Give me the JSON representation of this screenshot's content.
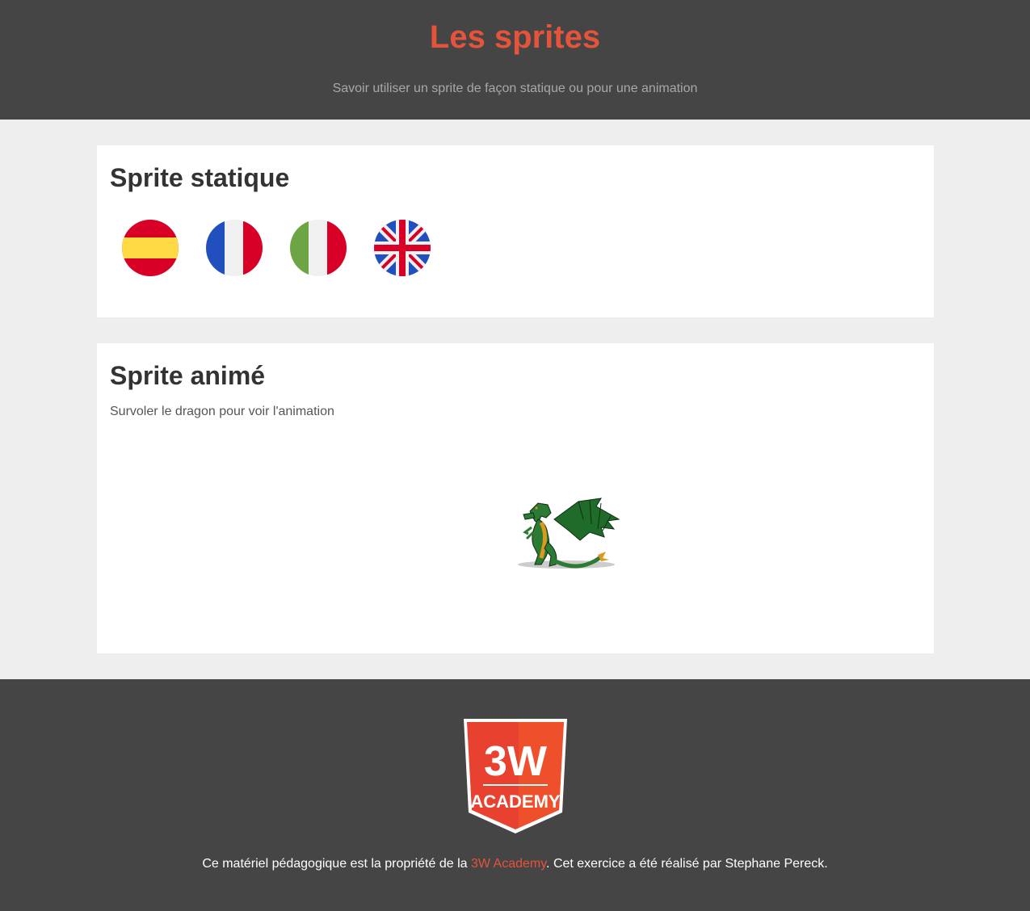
{
  "header": {
    "title": "Les sprites",
    "subtitle": "Savoir utiliser un sprite de façon statique ou pour une animation"
  },
  "static_section": {
    "title": "Sprite statique",
    "flags": [
      "spain-flag-icon",
      "france-flag-icon",
      "italy-flag-icon",
      "uk-flag-icon"
    ]
  },
  "animated_section": {
    "title": "Sprite animé",
    "hint": "Survoler le dragon pour voir l'animation",
    "sprite": "dragon-sprite"
  },
  "footer": {
    "logo_top": "3W",
    "logo_bottom": "ACADEMY",
    "text_before": "Ce matériel pédagogique est la propriété de la ",
    "link_text": "3W Academy",
    "text_after": ". Cet exercice a été réalisé par Stephane Pereck."
  },
  "colors": {
    "accent": "#e5533a",
    "header_bg": "#454545",
    "page_bg": "#eeeeee"
  }
}
